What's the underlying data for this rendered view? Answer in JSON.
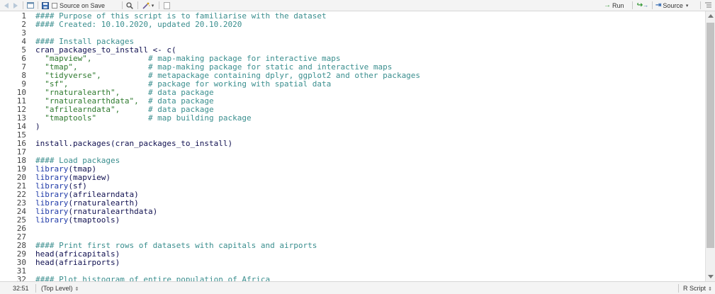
{
  "toolbar": {
    "source_on_save_label": "Source on Save",
    "run_label": "Run",
    "source_label": "Source",
    "icons": [
      "back-arrow-icon",
      "forward-arrow-icon",
      "show-in-window-icon",
      "save-icon",
      "search-icon",
      "magic-wand-icon",
      "compile-report-icon",
      "rerun-icon",
      "outline-icon"
    ]
  },
  "editor": {
    "lines": [
      {
        "n": "1",
        "segs": [
          {
            "t": "#### Purpose of this script is to familiarise with the dataset",
            "c": "comment"
          }
        ]
      },
      {
        "n": "2",
        "segs": [
          {
            "t": "#### Created: 10.10.2020, updated 20.10.2020",
            "c": "comment"
          }
        ]
      },
      {
        "n": "3",
        "segs": []
      },
      {
        "n": "4",
        "segs": [
          {
            "t": "#### Install packages",
            "c": "comment"
          }
        ]
      },
      {
        "n": "5",
        "segs": [
          {
            "t": "cran_packages_to_install <- c(",
            "c": "plain"
          }
        ]
      },
      {
        "n": "6",
        "segs": [
          {
            "t": "  \"mapview\",",
            "c": "string"
          },
          {
            "t": "            # map-making package for interactive maps",
            "c": "comment"
          }
        ]
      },
      {
        "n": "7",
        "segs": [
          {
            "t": "  \"tmap\",",
            "c": "string"
          },
          {
            "t": "               # map-making package for static and interactive maps",
            "c": "comment"
          }
        ]
      },
      {
        "n": "8",
        "segs": [
          {
            "t": "  \"tidyverse\",",
            "c": "string"
          },
          {
            "t": "          # metapackage containing dplyr, ggplot2 and other packages",
            "c": "comment"
          }
        ]
      },
      {
        "n": "9",
        "segs": [
          {
            "t": "  \"sf\",",
            "c": "string"
          },
          {
            "t": "                 # package for working with spatial data",
            "c": "comment"
          }
        ]
      },
      {
        "n": "10",
        "segs": [
          {
            "t": "  \"rnaturalearth\",",
            "c": "string"
          },
          {
            "t": "      # data package",
            "c": "comment"
          }
        ]
      },
      {
        "n": "11",
        "segs": [
          {
            "t": "  \"rnaturalearthdata\",",
            "c": "string"
          },
          {
            "t": "  # data package",
            "c": "comment"
          }
        ]
      },
      {
        "n": "12",
        "segs": [
          {
            "t": "  \"afrilearndata\",",
            "c": "string"
          },
          {
            "t": "      # data package",
            "c": "comment"
          }
        ]
      },
      {
        "n": "13",
        "segs": [
          {
            "t": "  \"tmaptools\"",
            "c": "string"
          },
          {
            "t": "           # map building package",
            "c": "comment"
          }
        ]
      },
      {
        "n": "14",
        "segs": [
          {
            "t": ")",
            "c": "plain"
          }
        ]
      },
      {
        "n": "15",
        "segs": []
      },
      {
        "n": "16",
        "segs": [
          {
            "t": "install.packages(cran_packages_to_install)",
            "c": "plain"
          }
        ]
      },
      {
        "n": "17",
        "segs": []
      },
      {
        "n": "18",
        "segs": [
          {
            "t": "#### Load packages",
            "c": "comment"
          }
        ]
      },
      {
        "n": "19",
        "segs": [
          {
            "t": "library",
            "c": "func"
          },
          {
            "t": "(tmap)",
            "c": "plain"
          }
        ]
      },
      {
        "n": "20",
        "segs": [
          {
            "t": "library",
            "c": "func"
          },
          {
            "t": "(mapview)",
            "c": "plain"
          }
        ]
      },
      {
        "n": "21",
        "segs": [
          {
            "t": "library",
            "c": "func"
          },
          {
            "t": "(sf)",
            "c": "plain"
          }
        ]
      },
      {
        "n": "22",
        "segs": [
          {
            "t": "library",
            "c": "func"
          },
          {
            "t": "(afrilearndata)",
            "c": "plain"
          }
        ]
      },
      {
        "n": "23",
        "segs": [
          {
            "t": "library",
            "c": "func"
          },
          {
            "t": "(rnaturalearth)",
            "c": "plain"
          }
        ]
      },
      {
        "n": "24",
        "segs": [
          {
            "t": "library",
            "c": "func"
          },
          {
            "t": "(rnaturalearthdata)",
            "c": "plain"
          }
        ]
      },
      {
        "n": "25",
        "segs": [
          {
            "t": "library",
            "c": "func"
          },
          {
            "t": "(tmaptools)",
            "c": "plain"
          }
        ]
      },
      {
        "n": "26",
        "segs": []
      },
      {
        "n": "27",
        "segs": []
      },
      {
        "n": "28",
        "segs": [
          {
            "t": "#### Print first rows of datasets with capitals and airports",
            "c": "comment"
          }
        ]
      },
      {
        "n": "29",
        "segs": [
          {
            "t": "head(africapitals)",
            "c": "plain"
          }
        ]
      },
      {
        "n": "30",
        "segs": [
          {
            "t": "head(afriairports)",
            "c": "plain"
          }
        ]
      },
      {
        "n": "31",
        "segs": []
      },
      {
        "n": "32",
        "segs": [
          {
            "t": "#### Plot histogram of entire population of Africa",
            "c": "comment"
          }
        ]
      }
    ]
  },
  "status": {
    "cursor": "32:51",
    "scope": "(Top Level)",
    "file_type": "R Script"
  },
  "colors": {
    "comment": "#3a8e8e",
    "string": "#2e7a2e",
    "function": "#1f3aa8",
    "plain": "#101050"
  }
}
